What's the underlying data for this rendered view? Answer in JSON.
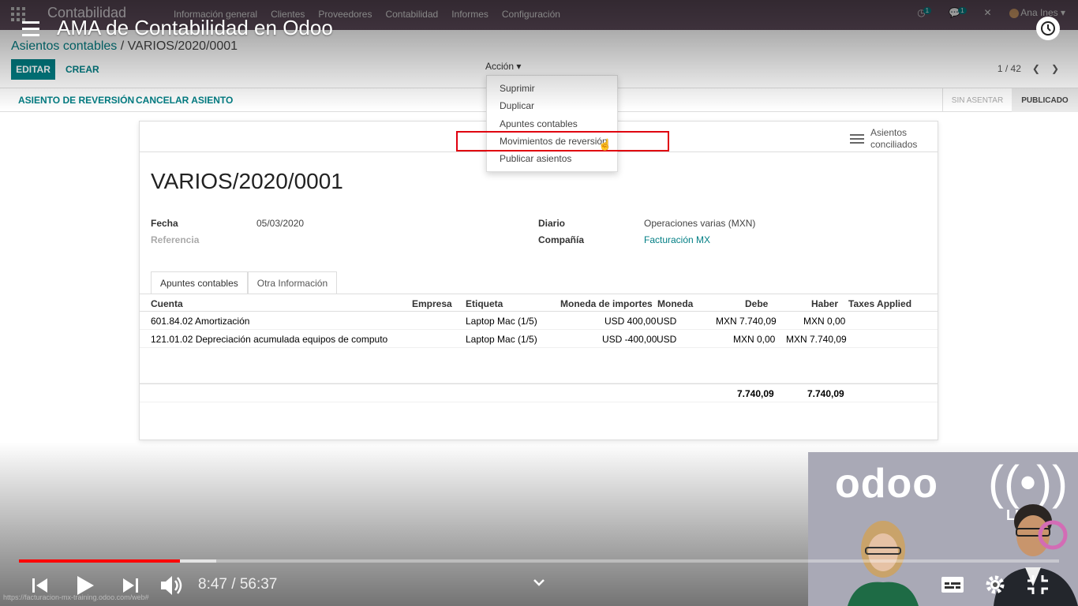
{
  "navbar": {
    "brand": "Contabilidad",
    "menus": [
      "Información general",
      "Clientes",
      "Proveedores",
      "Contabilidad",
      "Informes",
      "Configuración"
    ],
    "activity_count": "1",
    "message_count": "1",
    "user": "Ana Ines"
  },
  "breadcrumb": {
    "parent": "Asientos contables",
    "separator": "/",
    "current": "VARIOS/2020/0001"
  },
  "buttons": {
    "edit": "EDITAR",
    "create": "CREAR",
    "action": "Acción",
    "reversal": "ASIENTO DE REVERSIÓN",
    "cancel": "CANCELAR ASIENTO"
  },
  "pager": {
    "text": "1 / 42"
  },
  "statusbar": {
    "draft": "SIN ASENTAR",
    "posted": "PUBLICADO",
    "active": "posted"
  },
  "action_menu": {
    "items": [
      "Suprimir",
      "Duplicar",
      "Apuntes contables",
      "Movimientos de reversión",
      "Publicar asientos"
    ],
    "highlighted": "Movimientos de reversión"
  },
  "smart_button": {
    "line1": "Asientos",
    "line2": "conciliados"
  },
  "record": {
    "name": "VARIOS/2020/0001",
    "fecha_label": "Fecha",
    "fecha": "05/03/2020",
    "referencia_label": "Referencia",
    "diario_label": "Diario",
    "diario": "Operaciones varias (MXN)",
    "compania_label": "Compañía",
    "compania": "Facturación MX"
  },
  "tabs": [
    "Apuntes contables",
    "Otra Información"
  ],
  "table": {
    "headers": [
      "Cuenta",
      "Empresa",
      "Etiqueta",
      "Moneda de importes",
      "Moneda",
      "Debe",
      "Haber",
      "Taxes Applied"
    ],
    "rows": [
      [
        "601.84.02 Amortización",
        "",
        "Laptop Mac (1/5)",
        "USD 400,00",
        "USD",
        "MXN 7.740,09",
        "MXN 0,00",
        ""
      ],
      [
        "121.01.02 Depreciación acumulada equipos de computo",
        "",
        "Laptop Mac (1/5)",
        "USD -400,00",
        "USD",
        "MXN 0,00",
        "MXN 7.740,09",
        ""
      ]
    ],
    "totals": {
      "debe": "7.740,09",
      "haber": "7.740,09"
    }
  },
  "video": {
    "title": "AMA de Contabilidad en Odoo",
    "current_time": "8:47",
    "duration": "56:37",
    "progress": 0.155,
    "buffered": 0.19,
    "status_url": "https://facturacion-mx-training.odoo.com/web#"
  },
  "webcam": {
    "logo": "odoo",
    "live": "LIVE"
  },
  "colors": {
    "brand": "#017e84",
    "navbar": "#5c4a59",
    "highlight_box": "#e0000f",
    "progress": "#ff0000"
  }
}
